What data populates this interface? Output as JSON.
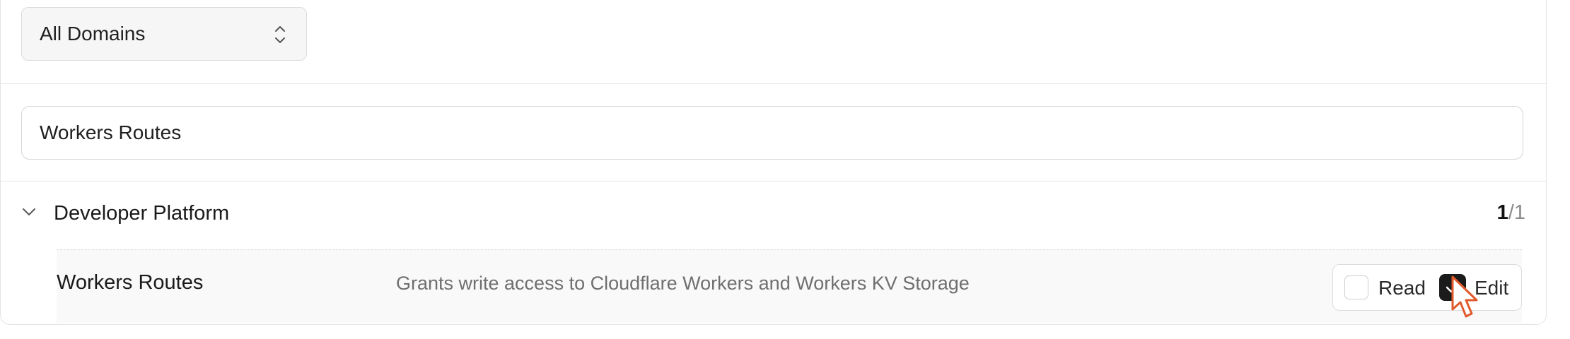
{
  "filters": {
    "domain_select_value": "All Domains",
    "search_value": "Workers Routes"
  },
  "group": {
    "title": "Developer Platform",
    "count_selected": "1",
    "count_separator": "/",
    "count_total": "1"
  },
  "permission": {
    "name": "Workers Routes",
    "description": "Grants write access to Cloudflare Workers and Workers KV Storage",
    "read_label": "Read",
    "read_checked": false,
    "edit_label": "Edit",
    "edit_checked": true
  },
  "icons": {
    "select_icon": "updown-chevron-icon",
    "group_toggle_icon": "chevron-down-icon",
    "check_icon": "checkmark-icon",
    "cursor": "pointer-hand-cursor"
  },
  "colors": {
    "checkbox_checked": "#1b1b1b",
    "row_background": "#f9f9f9",
    "cursor_accent": "#e05a2c"
  }
}
